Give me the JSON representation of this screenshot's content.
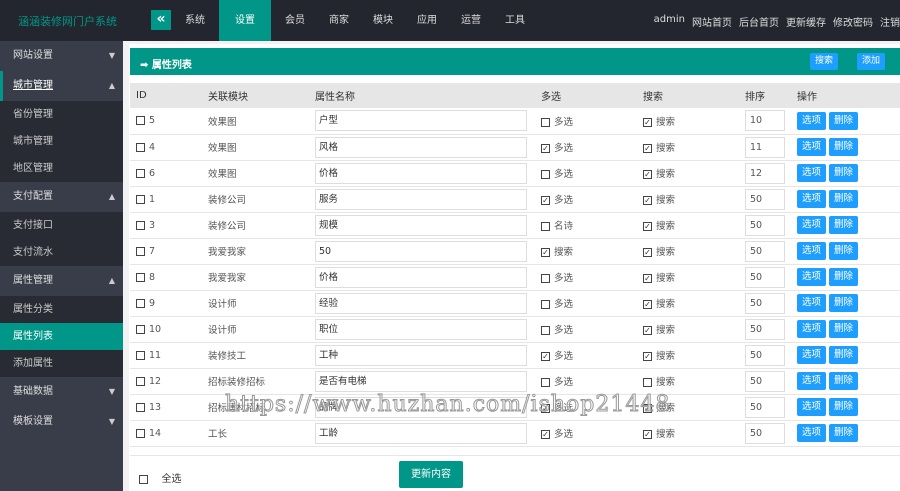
{
  "header": {
    "logo": "涵涵装修网门户系统",
    "toggle_icon": "double-chevron-left-icon",
    "nav": [
      {
        "label": "系统"
      },
      {
        "label": "设置",
        "active": true
      },
      {
        "label": "会员"
      },
      {
        "label": "商家"
      },
      {
        "label": "模块"
      },
      {
        "label": "应用"
      },
      {
        "label": "运营"
      },
      {
        "label": "工具"
      }
    ],
    "right": [
      "admin",
      "网站首页",
      "后台首页",
      "更新缓存",
      "修改密码",
      "注销"
    ]
  },
  "sidebar": [
    {
      "label": "网站设置",
      "expanded": false
    },
    {
      "label": "城市管理",
      "expanded": true,
      "current": true,
      "items": [
        {
          "label": "省份管理"
        },
        {
          "label": "城市管理"
        },
        {
          "label": "地区管理"
        }
      ]
    },
    {
      "label": "支付配置",
      "expanded": true,
      "items": [
        {
          "label": "支付接口"
        },
        {
          "label": "支付流水"
        }
      ]
    },
    {
      "label": "属性管理",
      "expanded": true,
      "items": [
        {
          "label": "属性分类"
        },
        {
          "label": "属性列表",
          "active": true
        },
        {
          "label": "添加属性"
        }
      ]
    },
    {
      "label": "基础数据",
      "expanded": false
    },
    {
      "label": "模板设置",
      "expanded": false
    }
  ],
  "panel": {
    "title": "属性列表",
    "search_label": "搜索",
    "add_label": "添加"
  },
  "table": {
    "columns": [
      "ID",
      "关联模块",
      "属性名称",
      "多选",
      "搜索",
      "排序",
      "操作"
    ],
    "option_label": "选项",
    "delete_label": "删除",
    "rows": [
      {
        "id": "5",
        "module": "效果图",
        "name": "户型",
        "multi": false,
        "multi_label": "多选",
        "search": true,
        "search_label": "搜索",
        "order": "10"
      },
      {
        "id": "4",
        "module": "效果图",
        "name": "风格",
        "multi": true,
        "multi_label": "多选",
        "search": true,
        "search_label": "搜索",
        "order": "11"
      },
      {
        "id": "6",
        "module": "效果图",
        "name": "价格",
        "multi": false,
        "multi_label": "多选",
        "search": true,
        "search_label": "搜索",
        "order": "12"
      },
      {
        "id": "1",
        "module": "装修公司",
        "name": "服务",
        "multi": true,
        "multi_label": "多选",
        "search": true,
        "search_label": "搜索",
        "order": "50"
      },
      {
        "id": "3",
        "module": "装修公司",
        "name": "规模",
        "multi": false,
        "multi_label": "名诗",
        "search": true,
        "search_label": "搜索",
        "order": "50"
      },
      {
        "id": "7",
        "module": "我爱我家",
        "name": "50",
        "multi": true,
        "multi_label": "搜索",
        "search": true,
        "search_label": "搜索",
        "order": "50"
      },
      {
        "id": "8",
        "module": "我爱我家",
        "name": "价格",
        "multi": false,
        "multi_label": "多选",
        "search": true,
        "search_label": "搜索",
        "order": "50"
      },
      {
        "id": "9",
        "module": "设计师",
        "name": "经验",
        "multi": false,
        "multi_label": "多选",
        "search": true,
        "search_label": "搜索",
        "order": "50"
      },
      {
        "id": "10",
        "module": "设计师",
        "name": "职位",
        "multi": false,
        "multi_label": "多选",
        "search": true,
        "search_label": "搜索",
        "order": "50"
      },
      {
        "id": "11",
        "module": "装修技工",
        "name": "工种",
        "multi": true,
        "multi_label": "多选",
        "search": true,
        "search_label": "搜索",
        "order": "50"
      },
      {
        "id": "12",
        "module": "招标装修招标",
        "name": "是否有电梯",
        "multi": false,
        "multi_label": "多选",
        "search": false,
        "search_label": "搜索",
        "order": "50"
      },
      {
        "id": "13",
        "module": "招标建材招标",
        "name": "品牌",
        "multi": true,
        "multi_label": "多选",
        "search": true,
        "search_label": "搜索",
        "order": "50"
      },
      {
        "id": "14",
        "module": "工长",
        "name": "工龄",
        "multi": true,
        "multi_label": "多选",
        "search": true,
        "search_label": "搜索",
        "order": "50"
      }
    ]
  },
  "footer": {
    "select_all": "全选",
    "update_label": "更新内容"
  },
  "watermark": "https://www.huzhan.com/ishop21448",
  "colors": {
    "accent": "#009688",
    "button": "#1e9fff",
    "topbar": "#23262e",
    "sidebar": "#393d49"
  }
}
